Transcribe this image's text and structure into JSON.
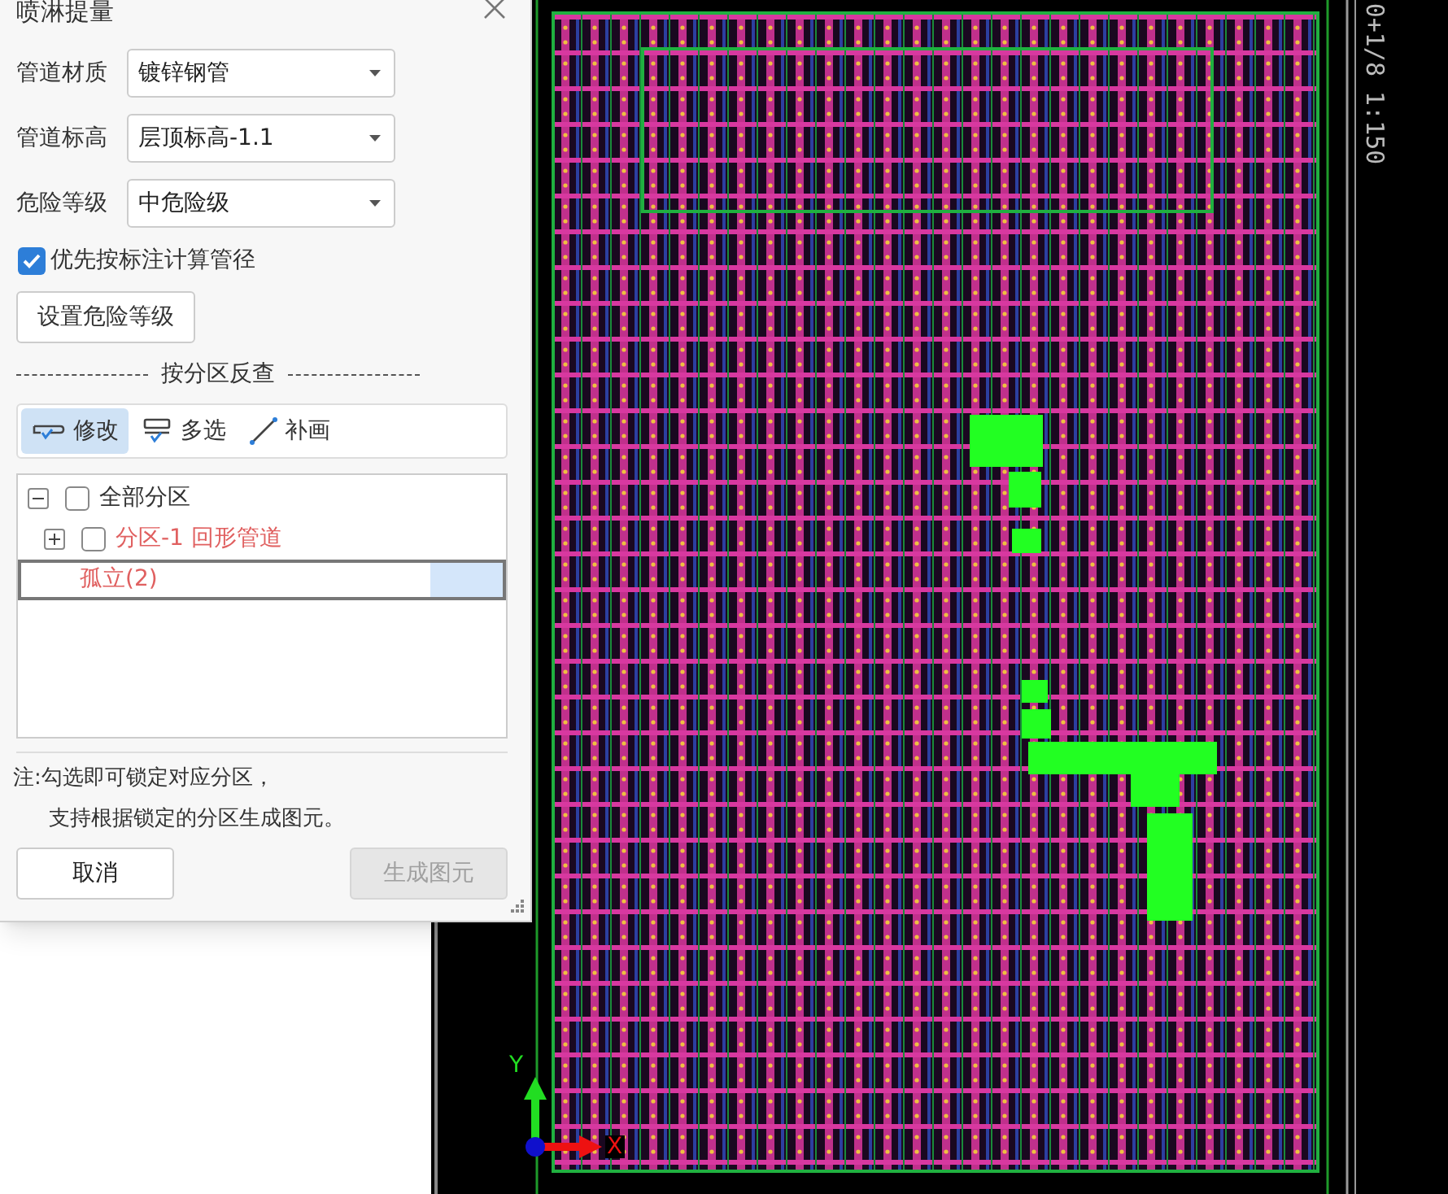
{
  "dialog": {
    "title": "喷淋提量",
    "fields": [
      {
        "label": "管道材质",
        "value": "镀锌钢管"
      },
      {
        "label": "管道标高",
        "value": "层顶标高-1.1"
      },
      {
        "label": "危险等级",
        "value": "中危险级"
      }
    ],
    "checkbox": {
      "label": "优先按标注计算管径",
      "checked": true
    },
    "level_button": "设置危险等级",
    "section_title": "按分区反查",
    "tools": [
      {
        "label": "修改",
        "selected": true
      },
      {
        "label": "多选",
        "selected": false
      },
      {
        "label": "补画",
        "selected": false
      }
    ],
    "tree": [
      {
        "label": "全部分区",
        "kind": "checkbox",
        "checked": false,
        "expanded": true,
        "selected": false,
        "children": [
          {
            "label": "分区-1 回形管道",
            "kind": "checkbox",
            "checked": false,
            "expanded": false,
            "selected": false,
            "color": "#e06060"
          },
          {
            "label": "孤立(2)",
            "kind": "plain",
            "selected": true,
            "color": "#e06060"
          }
        ]
      }
    ],
    "note": [
      "注:勾选即可锁定对应分区，",
      "支持根据锁定的分区生成图元。"
    ],
    "buttons": [
      {
        "label": "取消",
        "disabled": false
      },
      {
        "label": "生成图元",
        "disabled": true
      }
    ]
  },
  "canvas": {
    "scale_label": "0+1/8 1:150",
    "axis_labels": [
      "Y",
      "X"
    ]
  }
}
